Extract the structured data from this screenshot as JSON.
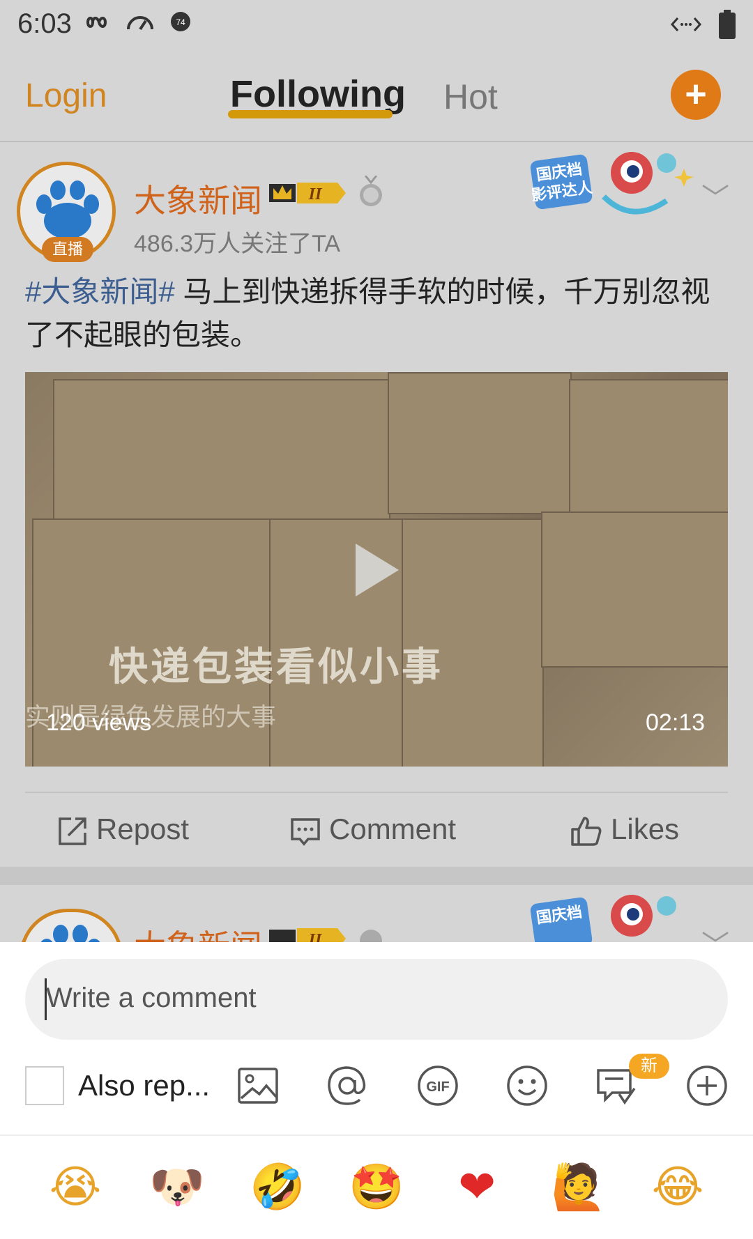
{
  "status_bar": {
    "time": "6:03",
    "battery_level": "full"
  },
  "nav": {
    "login": "Login",
    "tabs": [
      "Following",
      "Hot"
    ],
    "active_tab": "Following",
    "add_icon": "plus-icon"
  },
  "post": {
    "author": "大象新闻",
    "live_badge": "直播",
    "followers_text": "486.3万人关注了TA",
    "vip_level": "II",
    "sticker_text": "国庆档 影评达人",
    "hashtag": "#大象新闻#",
    "body": " 马上到快递拆得手软的时候，千万别忽视了不起眼的包装。",
    "video": {
      "views": "120 views",
      "duration": "02:13",
      "caption_main": "快递包装看似小事",
      "caption_sub": "实则是绿色发展的大事"
    },
    "actions": {
      "repost": "Repost",
      "comment": "Comment",
      "likes": "Likes"
    }
  },
  "next_post": {
    "author": "大象新闻",
    "vip_level": "II"
  },
  "composer": {
    "placeholder": "Write a comment",
    "also_repost": "Also rep...",
    "new_badge": "新",
    "tools": [
      "image-icon",
      "at-icon",
      "gif-icon",
      "emoji-icon",
      "topic-icon",
      "more-plus-icon"
    ]
  },
  "emoji_bar": [
    "😭",
    "🐶",
    "🤣",
    "🤩",
    "❤",
    "🙋",
    "😂"
  ],
  "colors": {
    "accent": "#d08520",
    "name": "#d0631c",
    "hashtag": "#3b5d8f",
    "add_button": "#e07a17"
  }
}
